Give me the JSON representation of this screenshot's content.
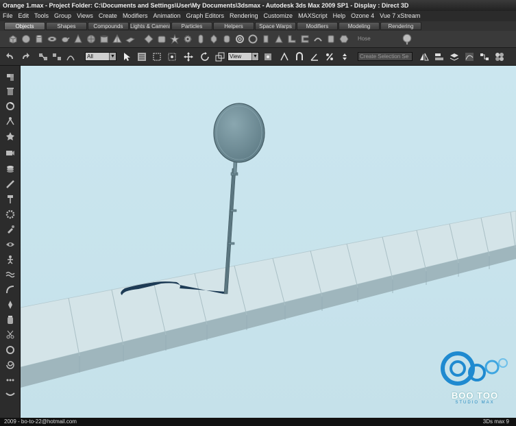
{
  "window": {
    "title": "Orange 1.max     - Project Folder: C:\\Documents and Settings\\User\\My Documents\\3dsmax      - Autodesk 3ds Max  2009 SP1         - Display : Direct 3D"
  },
  "menu": [
    "File",
    "Edit",
    "Tools",
    "Group",
    "Views",
    "Create",
    "Modifiers",
    "Animation",
    "Graph Editors",
    "Rendering",
    "Customize",
    "MAXScript",
    "Help",
    "Ozone 4",
    "Vue 7 xStream"
  ],
  "tabs": [
    "Objects",
    "Shapes",
    "Compounds",
    "Lights & Cameras",
    "Particles",
    "Helpers",
    "Space Warps",
    "Modifiers",
    "Modeling",
    "Rendering"
  ],
  "shelf": {
    "hose_label": "Hose"
  },
  "main_toolbar": {
    "filter_value": "All",
    "coord_value": "View",
    "selection_set_placeholder": "Create Selection Se"
  },
  "status": {
    "left": "2009  -  bo-to-22@hotmail.com",
    "right": "3Ds max 9"
  },
  "logo": {
    "name": "BOO TOO",
    "sub": "STUDIO MAX"
  },
  "colors": {
    "viewport_bg": "#c9e4ed",
    "object": "#6f8c96",
    "logo_blue": "#1f8ad0"
  }
}
